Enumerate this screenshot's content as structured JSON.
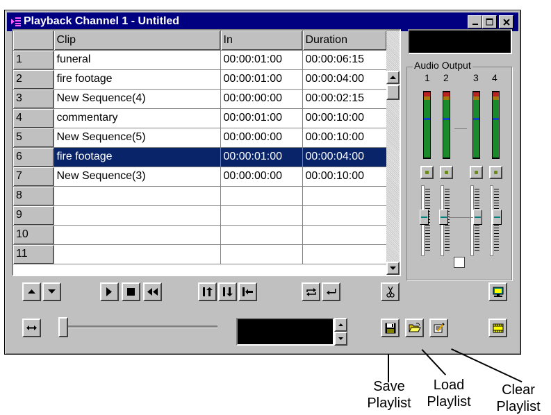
{
  "window": {
    "title": "Playback Channel 1 - Untitled",
    "controls": [
      "minimize-icon",
      "maximize-icon",
      "close-icon"
    ]
  },
  "table": {
    "columns": [
      "Clip",
      "In",
      "Duration"
    ],
    "rows": [
      {
        "num": "1",
        "clip": "funeral",
        "in": "00:00:01:00",
        "duration": "00:00:06:15"
      },
      {
        "num": "2",
        "clip": "fire footage",
        "in": "00:00:01:00",
        "duration": "00:00:04:00"
      },
      {
        "num": "3",
        "clip": "New Sequence(4)",
        "in": "00:00:00:00",
        "duration": "00:00:02:15"
      },
      {
        "num": "4",
        "clip": "commentary",
        "in": "00:00:01:00",
        "duration": "00:00:10:00"
      },
      {
        "num": "5",
        "clip": "New Sequence(5)",
        "in": "00:00:00:00",
        "duration": "00:00:10:00"
      },
      {
        "num": "6",
        "clip": "fire footage",
        "in": "00:00:01:00",
        "duration": "00:00:04:00",
        "selected": true
      },
      {
        "num": "7",
        "clip": "New Sequence(3)",
        "in": "00:00:00:00",
        "duration": "00:00:10:00"
      },
      {
        "num": "8",
        "clip": "",
        "in": "",
        "duration": ""
      },
      {
        "num": "9",
        "clip": "",
        "in": "",
        "duration": ""
      },
      {
        "num": "10",
        "clip": "",
        "in": "",
        "duration": ""
      },
      {
        "num": "11",
        "clip": "",
        "in": "",
        "duration": ""
      }
    ]
  },
  "audio": {
    "title": "Audio Output",
    "channels": [
      "1",
      "2",
      "3",
      "4"
    ]
  },
  "annotations": {
    "save": [
      "Save",
      "Playlist"
    ],
    "load": [
      "Load",
      "Playlist"
    ],
    "clear": [
      "Clear",
      "Playlist"
    ]
  },
  "colors": {
    "titlebar": "#000080",
    "selection": "#0a246a",
    "face": "#c0c0c0"
  }
}
